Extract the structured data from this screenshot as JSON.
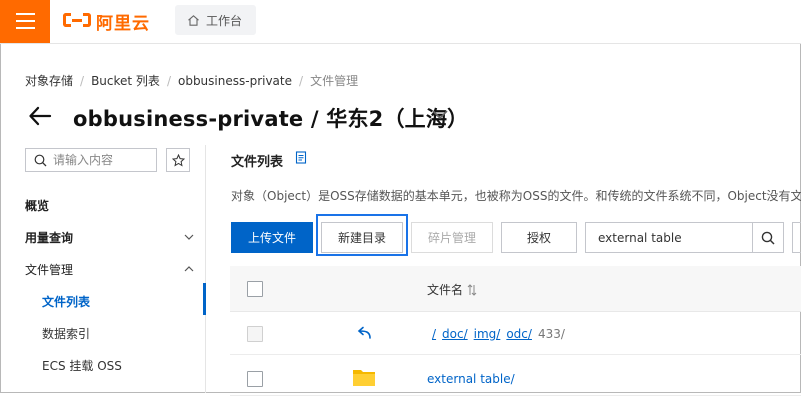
{
  "topbar": {
    "logo_text": "阿里云",
    "workbench_label": "工作台",
    "brand_color": "#ff6a00"
  },
  "breadcrumb": [
    {
      "label": "对象存储"
    },
    {
      "label": "Bucket 列表"
    },
    {
      "label": "obbusiness-private"
    },
    {
      "label": "文件管理"
    }
  ],
  "page": {
    "title": "obbusiness-private / 华东2（上海）"
  },
  "sidebar": {
    "search_placeholder": "请输入内容",
    "items": [
      {
        "label": "概览"
      },
      {
        "label": "用量查询"
      },
      {
        "label": "文件管理"
      },
      {
        "label": "文件列表"
      },
      {
        "label": "数据索引"
      },
      {
        "label": "ECS 挂载 OSS"
      }
    ],
    "accent_color": "#0064c8"
  },
  "main": {
    "section_title": "文件列表",
    "description": "对象（Object）是OSS存储数据的基本单元，也被称为OSS的文件。和传统的文件系统不同，Object没有文件",
    "buttons": {
      "upload": "上传文件",
      "new_dir": "新建目录",
      "fragments": "碎片管理",
      "authorize": "授权"
    },
    "filter_value": "external table"
  },
  "table": {
    "header_name": "文件名",
    "path_segments": [
      "/",
      "doc/",
      "img/",
      "odc/"
    ],
    "path_tail": "433/",
    "rows": [
      {
        "name": "external table/"
      }
    ]
  }
}
